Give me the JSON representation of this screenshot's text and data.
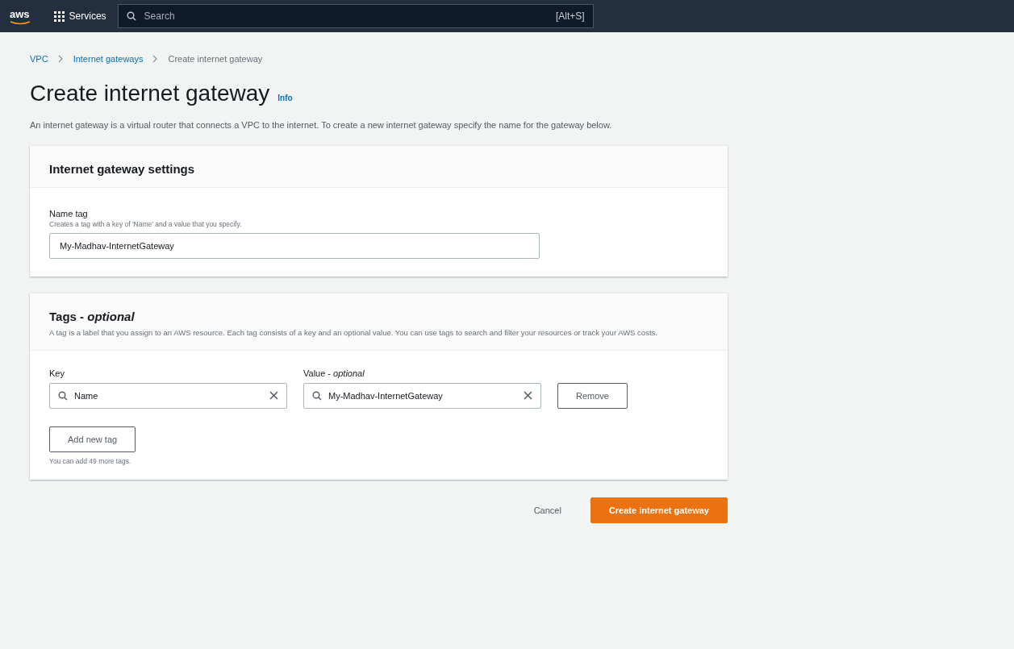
{
  "top_bar": {
    "logo": "aws",
    "services": "Services",
    "search_placeholder": "Search",
    "shortcut": "[Alt+S]"
  },
  "breadcrumbs": [
    {
      "label": "VPC",
      "link": true
    },
    {
      "label": "Internet gateways",
      "link": true
    },
    {
      "label": "Create internet gateway",
      "link": false
    }
  ],
  "title": "Create internet gateway",
  "info": "Info",
  "description": "An internet gateway is a virtual router that connects a VPC to the internet. To create a new internet gateway specify the name for the gateway below.",
  "settings": {
    "heading": "Internet gateway settings",
    "label": "Name tag",
    "hint": "Creates a tag with a key of 'Name' and a value that you specify.",
    "value": "My-Madhav-InternetGateway"
  },
  "tags": {
    "heading": "Tags - *optional*",
    "description": "A tag is a label that you assign to an AWS resource. Each tag consists of a key and an optional value. You can use tags to search and filter your resources or track your AWS costs.",
    "key_label": "Key",
    "value_label": "Value - *optional*",
    "rows": [
      {
        "key": "Name",
        "value": "My-Madhav-InternetGateway",
        "remove": "Remove"
      }
    ],
    "add_button": "Add new tag",
    "limit_note": "You can add 49 more tags."
  },
  "actions": {
    "cancel": "Cancel",
    "submit": "Create internet gateway"
  }
}
